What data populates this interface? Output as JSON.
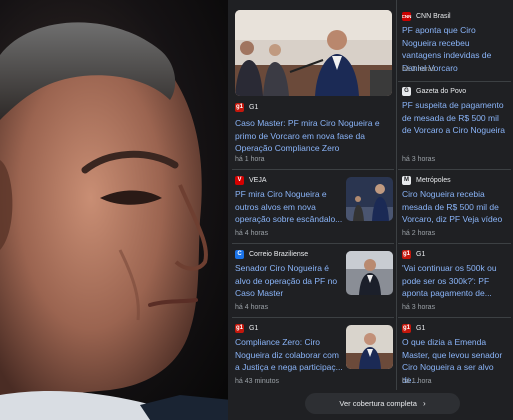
{
  "articles": [
    {
      "source": "G1",
      "headline": "Caso Master: PF mira Ciro Nogueira e primo de Vorcaro em nova fase da Operação Compliance Zero",
      "time": "há 1 hora",
      "icon": "g1-logo-icon",
      "icon_color": "#c4170c"
    },
    {
      "source": "CNN Brasil",
      "headline": "PF aponta que Ciro Nogueira recebeu vantagens indevidas de Daniel Vorcaro",
      "time": "há 3 horas",
      "icon": "cnn-logo-icon",
      "icon_color": "#cc0000"
    },
    {
      "source": "Gazeta do Povo",
      "headline": "PF suspeita de pagamento de mesada de R$ 500 mil de Vorcaro a Ciro Nogueira",
      "time": "há 3 horas",
      "icon": "gazeta-logo-icon",
      "icon_color": "#e8eaed"
    },
    {
      "source": "VEJA",
      "headline": "PF mira Ciro Nogueira e outros alvos em nova operação sobre escândalo...",
      "time": "há 4 horas",
      "icon": "veja-logo-icon",
      "icon_color": "#d50000"
    },
    {
      "source": "Metrópoles",
      "headline": "Ciro Nogueira recebia mesada de R$ 500 mil de Vorcaro, diz PF Veja vídeo",
      "time": "há 2 horas",
      "icon": "metropoles-logo-icon",
      "icon_color": "#e8eaed"
    },
    {
      "source": "Correio Braziliense",
      "headline": "Senador Ciro Nogueira é alvo de operação da PF no Caso Master",
      "time": "há 4 horas",
      "icon": "correio-logo-icon",
      "icon_color": "#1a73e8"
    },
    {
      "source": "G1",
      "headline": "'Vai continuar os 500k ou pode ser os 300k?': PF aponta pagamento de...",
      "time": "há 3 horas",
      "icon": "g1-logo-icon",
      "icon_color": "#c4170c"
    },
    {
      "source": "G1",
      "headline": "Compliance Zero: Ciro Nogueira diz colaborar com a Justiça e nega participaç...",
      "time": "há 43 minutos",
      "icon": "g1-logo-icon",
      "icon_color": "#c4170c"
    },
    {
      "source": "G1",
      "headline": "O que dizia a Emenda Master, que levou senador Ciro Nogueira a ser alvo de...",
      "time": "há 1 hora",
      "icon": "g1-logo-icon",
      "icon_color": "#c4170c"
    }
  ],
  "coverage_button": {
    "label": "Ver cobertura completa",
    "icon": "chevron-right-icon"
  }
}
